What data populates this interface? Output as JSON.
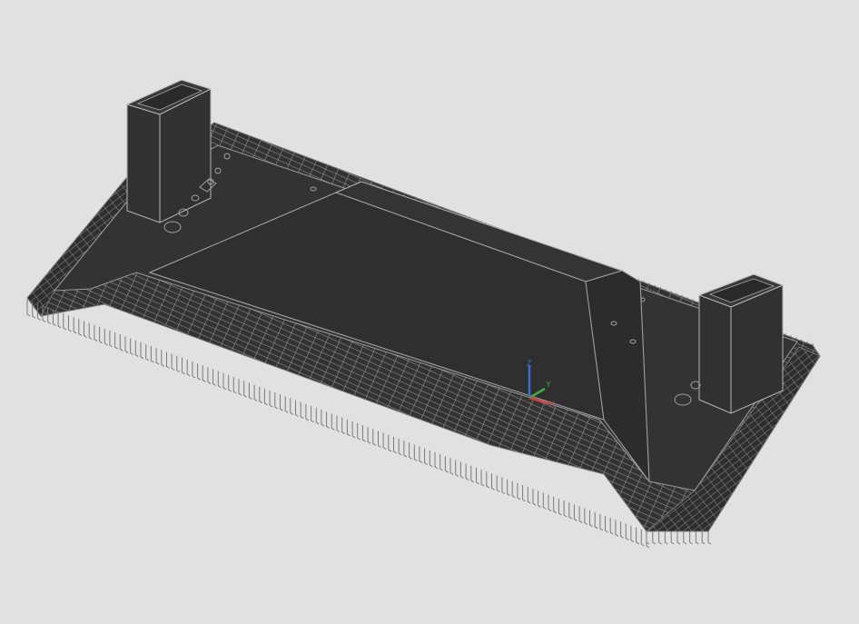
{
  "viewport": {
    "background_color": "#e1e1e1",
    "model_fill_color": "#333333",
    "edge_color": "#b8b8b8",
    "rebar_color": "#8a8a8a"
  },
  "ucs_icon": {
    "z_label": "Z",
    "y_label": "Y",
    "x_label": "X",
    "z_color": "#3b6fd6",
    "y_color": "#3fae3f",
    "x_color": "#d64040"
  }
}
